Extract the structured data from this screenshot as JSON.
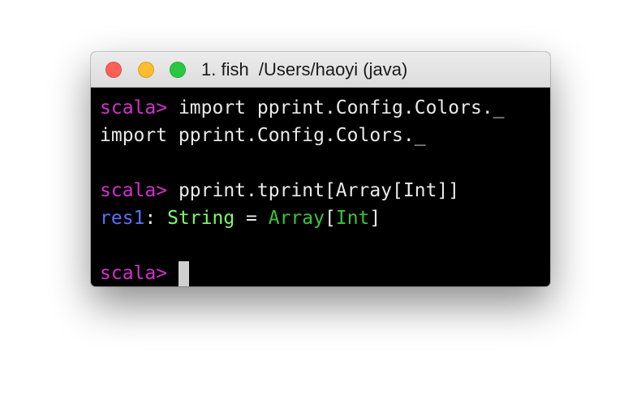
{
  "colors": {
    "close": "#fe5f57",
    "minimize": "#febc2e",
    "maximize": "#29c840",
    "prompt": "#d62fcf",
    "text": "#e9e9e9",
    "result_name": "#5b6ff7",
    "type_name": "#7dfa6e",
    "type_generic": "#3fc336",
    "cursor": "#cfcfcf"
  },
  "window": {
    "title": "1. fish  /Users/haoyi (java)",
    "buttons": {
      "close_icon": "close-icon",
      "minimize_icon": "minimize-icon",
      "maximize_icon": "maximize-icon"
    }
  },
  "terminal": {
    "prompt": "scala>",
    "lines": [
      {
        "prompt": "scala>",
        "command": " import pprint.Config.Colors._"
      },
      {
        "output": "import pprint.Config.Colors._"
      },
      {
        "blank": ""
      },
      {
        "prompt": "scala>",
        "command": " pprint.tprint[Array[Int]]"
      },
      {
        "result_name": "res1",
        "colon": ": ",
        "type_name": "String",
        "equals": " = ",
        "generic_outer": "Array",
        "bracket_open": "[",
        "generic_inner": "Int",
        "bracket_close": "]"
      },
      {
        "blank": ""
      },
      {
        "prompt": "scala>",
        "command": " "
      }
    ]
  }
}
